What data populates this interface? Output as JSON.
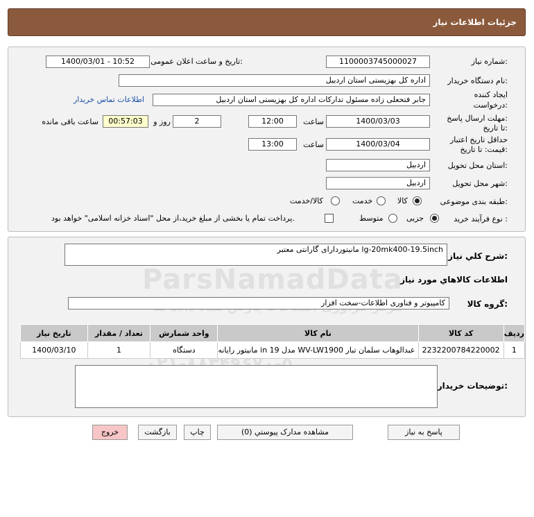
{
  "header": {
    "title": "جزئیات اطلاعات نیاز"
  },
  "form": {
    "need_number_label": "شماره نیاز:",
    "need_number": "1100003745000027",
    "announce_label": "تاریخ و ساعت اعلان عمومی:",
    "announce_value": "1400/03/01 - 10:52",
    "buyer_org_label": "نام دستگاه خریدار:",
    "buyer_org": "اداره کل بهزیستی استان اردبیل",
    "creator_label_1": "ایجاد کننده",
    "creator_label_2": "درخواست:",
    "creator": "جابر فتحعلی زاده مسئول تدارکات اداره کل بهزیستی استان اردبیل",
    "contact_link": "اطلاعات تماس خریدار",
    "deadline_label_1": "مهلت ارسال پاسخ:",
    "deadline_label_2": "تا تاریخ:",
    "deadline_date": "1400/03/03",
    "time_label": "ساعت",
    "deadline_time": "12:00",
    "days_value": "2",
    "days_label": "روز و",
    "remaining_time": "00:57:03",
    "remaining_label": "ساعت باقی مانده",
    "validity_label_1": "حداقل تاریخ اعتبار",
    "validity_label_2": "قیمت: تا تاریخ:",
    "validity_date": "1400/03/04",
    "validity_time_label": "ساعت",
    "validity_time": "13:00",
    "province_label": "استان محل تحویل:",
    "province": "اردبیل",
    "city_label": "شهر محل تحویل:",
    "city": "اردبیل",
    "category_label": "طبقه بندی موضوعی:",
    "category_options": [
      "کالا",
      "خدمت",
      "کالا/خدمت"
    ],
    "category_selected": "کالا",
    "process_label": "نوع فرآیند خرید :",
    "process_options": [
      "جزیی",
      "متوسط"
    ],
    "process_selected": "جزیی",
    "payment_text": "پرداخت تمام یا بخشی از مبلغ خرید،از محل \"اسناد خزانه اسلامی\" خواهد بود."
  },
  "details": {
    "summary_label": "شرح كلي نياز:",
    "summary": "مانیتوردارای گارانتی معتبر lg-20mk400-19.5inch",
    "goods_info_title": "اطلاعات كالاهاي مورد نياز",
    "group_label": "گروه کالا:",
    "group_value": "کامپیوتر و فناوری اطلاعات-سخت افزار",
    "table": {
      "headers": [
        "ردیف",
        "کد کالا",
        "نام کالا",
        "واحد شمارش",
        "تعداد / مقدار",
        "تاریخ نیاز"
      ],
      "rows": [
        [
          "1",
          "2232200784220002",
          "مانیتور رایانه in 19 مدل WV-LW1900 عبدالوهاب سلمان تبار",
          "دستگاه",
          "1",
          "1400/03/10"
        ]
      ]
    },
    "buyer_notes_label": "توضیحات خریدار:",
    "buyer_notes": ""
  },
  "buttons": {
    "reply": "پاسخ به نیاز",
    "attachments": "مشاهده مدارک پیوستي (0)",
    "print": "چاپ",
    "back": "بازگشت",
    "exit": "خروج"
  },
  "watermark": {
    "line1": "ParsNamadData",
    "line2": "مرکز فراوری اطلاعات پارس نماد داده ها",
    "line3": "پایگاه اطلاع رسانی مناقصه و مزایده",
    "line4": "۰۲۱-۸۸۳۴۹۶۷۰-۵"
  },
  "colors": {
    "header_bg": "#8b5a3c",
    "link": "#1a4fa8",
    "remaining_bg": "#ffffcc",
    "exit_bg": "#f8c6c6"
  }
}
